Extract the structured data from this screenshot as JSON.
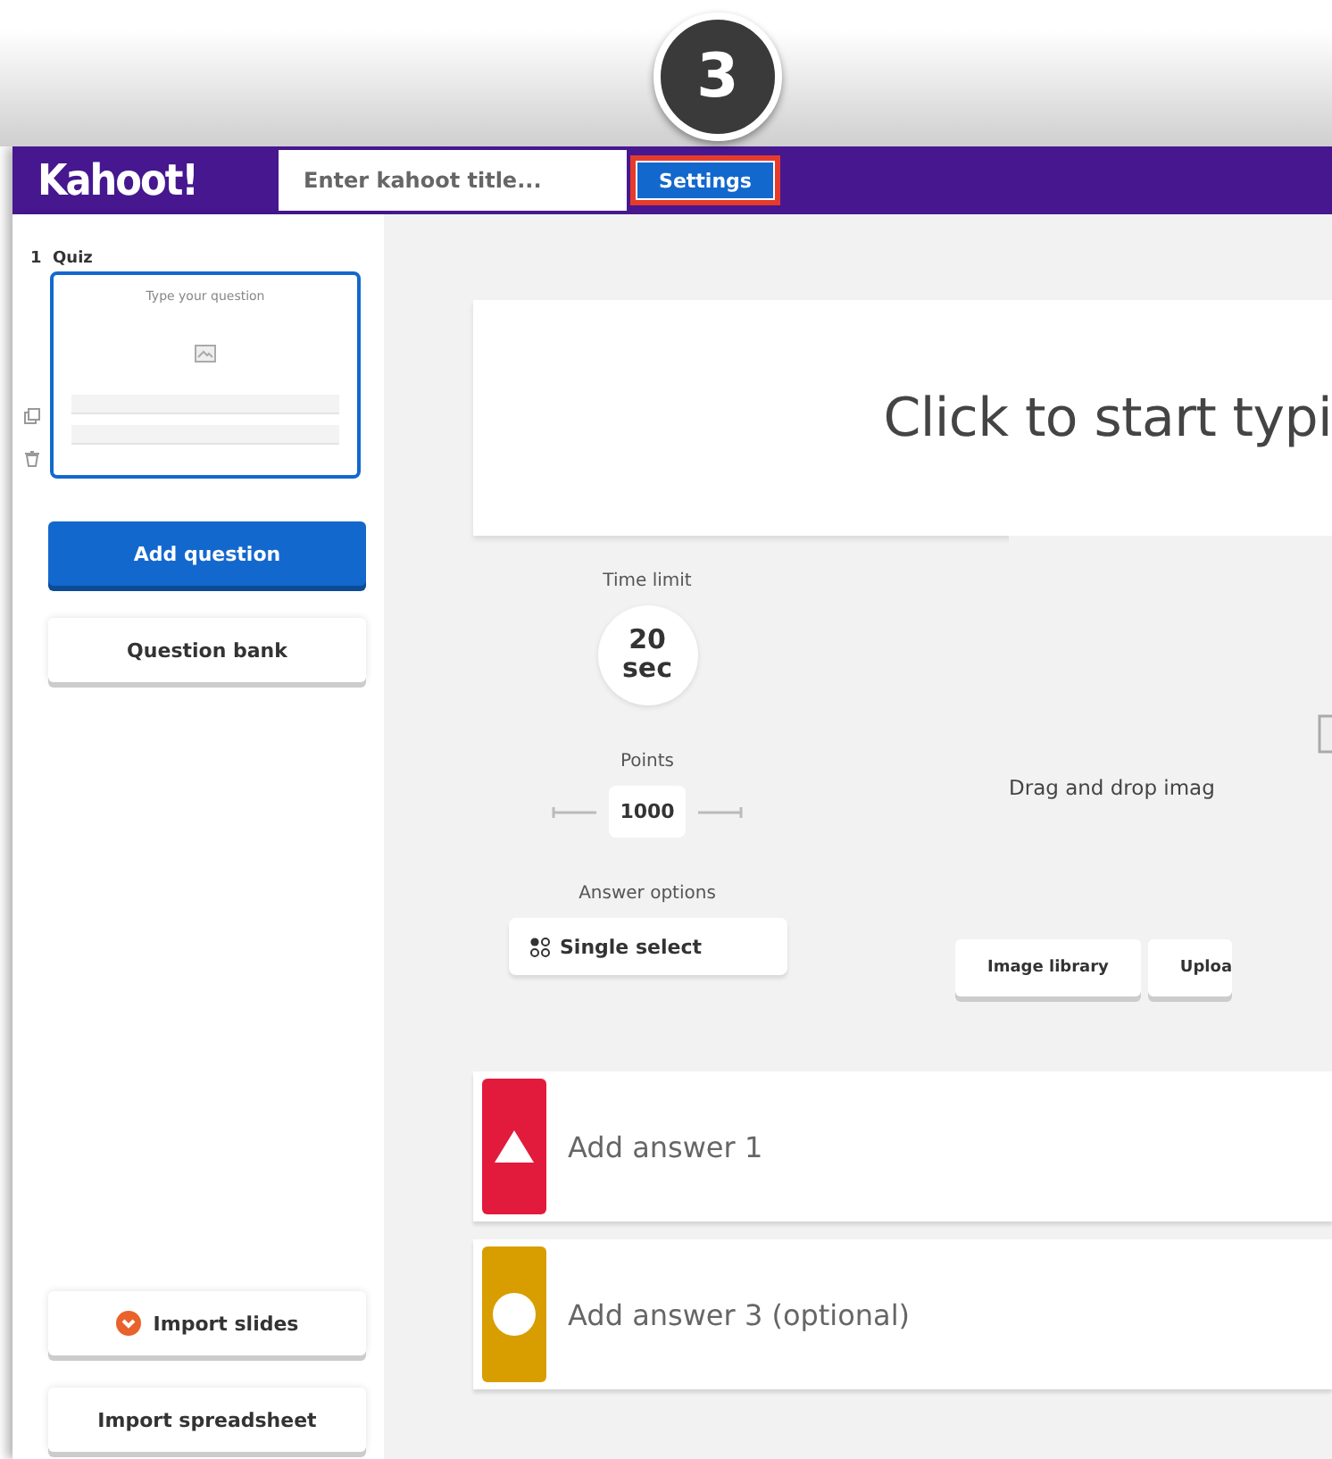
{
  "step_badge": "3",
  "header": {
    "logo": "Kahoot!",
    "title_field": {
      "placeholder": "Enter kahoot title..."
    },
    "settings_button": {
      "label": "Settings",
      "highlighted": true
    }
  },
  "sidebar": {
    "slides": [
      {
        "label": "1  Quiz",
        "thumbnail_text": "Type your question",
        "selected": true
      }
    ],
    "buttons": [
      {
        "label": "Add question",
        "kind": "primary"
      },
      {
        "label": "Question bank",
        "kind": "secondary"
      }
    ],
    "import_buttons": [
      {
        "label": "Import slides",
        "kind": "icon"
      },
      {
        "label": "Import spreadsheet",
        "kind": "plain"
      }
    ]
  },
  "question": {
    "placeholder": "Click to start typi"
  },
  "time_limit": {
    "label": "Time limit",
    "value": "20 sec"
  },
  "points": {
    "label": "Points",
    "value": "1000"
  },
  "answer_options": {
    "label": "Answer options",
    "value": "Single select"
  },
  "media": {
    "hint": "Drag and drop imag",
    "buttons": [
      "Image library",
      "Uploa"
    ]
  },
  "answers": [
    {
      "placeholder": "Add answer 1",
      "kind": "triangle",
      "color": "#e21b3c"
    },
    {
      "placeholder": "Add answer 3 (optional)",
      "kind": "circle",
      "color": "#d89e00"
    }
  ]
}
